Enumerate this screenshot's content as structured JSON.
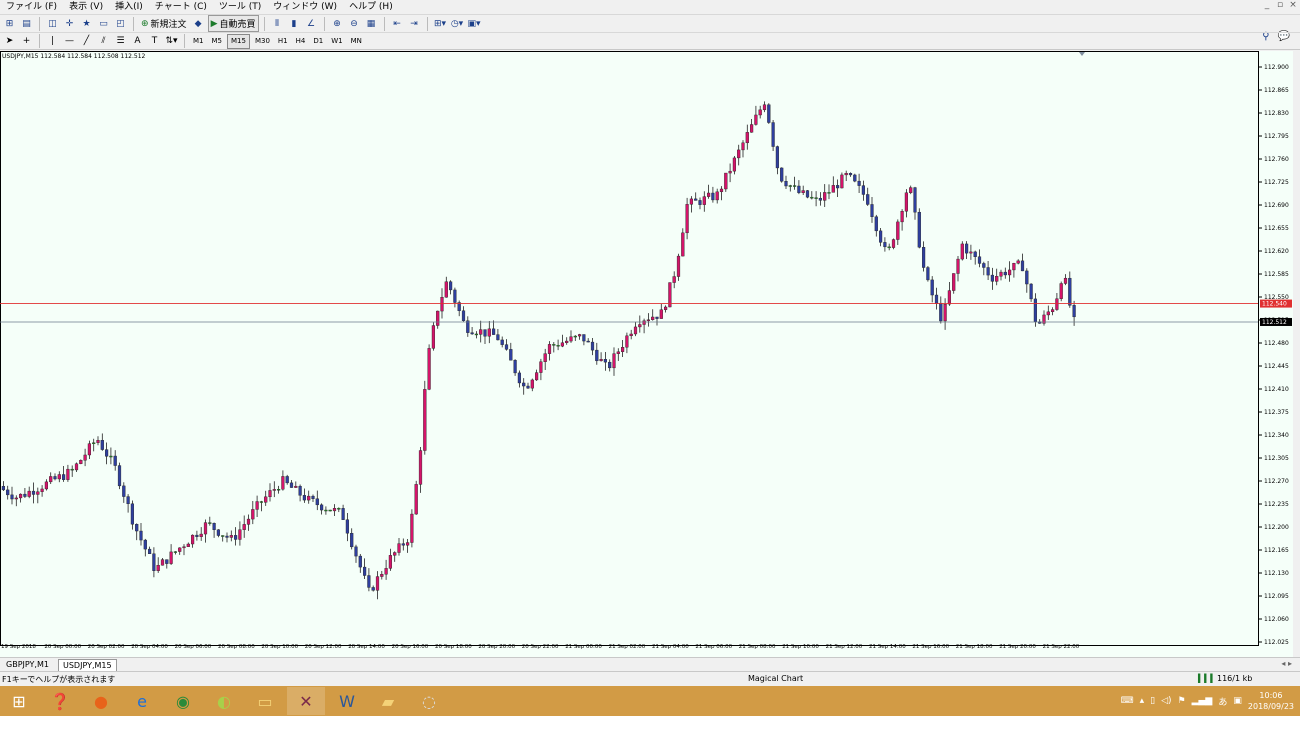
{
  "menu": [
    "ファイル (F)",
    "表示 (V)",
    "挿入(I)",
    "チャート (C)",
    "ツール (T)",
    "ウィンドウ (W)",
    "ヘルプ (H)"
  ],
  "toolbar": {
    "new_order": "新規注文",
    "auto_trade": "自動売買"
  },
  "timeframes": [
    "M1",
    "M5",
    "M15",
    "M30",
    "H1",
    "H4",
    "D1",
    "W1",
    "MN"
  ],
  "active_timeframe": "M15",
  "chart": {
    "info": "USDJPY,M15  112.584 112.584 112.508 112.512",
    "price_labels": [
      "112.900",
      "112.865",
      "112.830",
      "112.795",
      "112.760",
      "112.725",
      "112.690",
      "112.655",
      "112.620",
      "112.585",
      "112.550",
      "112.515",
      "112.480",
      "112.445",
      "112.410",
      "112.375",
      "112.340",
      "112.305",
      "112.270",
      "112.235",
      "112.200",
      "112.165",
      "112.130",
      "112.095",
      "112.060",
      "112.025"
    ],
    "time_labels": [
      "19 Sep 2018",
      "20 Sep 00:00",
      "20 Sep 02:00",
      "20 Sep 04:00",
      "20 Sep 06:00",
      "20 Sep 08:00",
      "20 Sep 10:00",
      "20 Sep 12:00",
      "20 Sep 14:00",
      "20 Sep 16:00",
      "20 Sep 18:00",
      "20 Sep 20:00",
      "20 Sep 22:00",
      "21 Sep 00:00",
      "21 Sep 02:00",
      "21 Sep 04:00",
      "21 Sep 06:00",
      "21 Sep 08:00",
      "21 Sep 10:00",
      "21 Sep 12:00",
      "21 Sep 14:00",
      "21 Sep 16:00",
      "21 Sep 18:00",
      "21 Sep 20:00",
      "21 Sep 22:00"
    ],
    "red_line_label": "112.540",
    "current_label": "112.512",
    "colors": {
      "bull": "#d4146a",
      "bear": "#2f3f9e",
      "doji": "#22aa22",
      "background": "#f5fff9",
      "red_line": "#e03030",
      "price_line": "#6a7a8a"
    }
  },
  "tabs": [
    "GBPJPY,M1",
    "USDJPY,M15"
  ],
  "active_tab": "USDJPY,M15",
  "status": {
    "help": "F1キーでヘルプが表示されます",
    "profile": "Magical Chart",
    "traffic": "116/1 kb"
  },
  "taskbar": {
    "time": "10:06",
    "date": "2018/09/23",
    "ime": "あ"
  }
}
